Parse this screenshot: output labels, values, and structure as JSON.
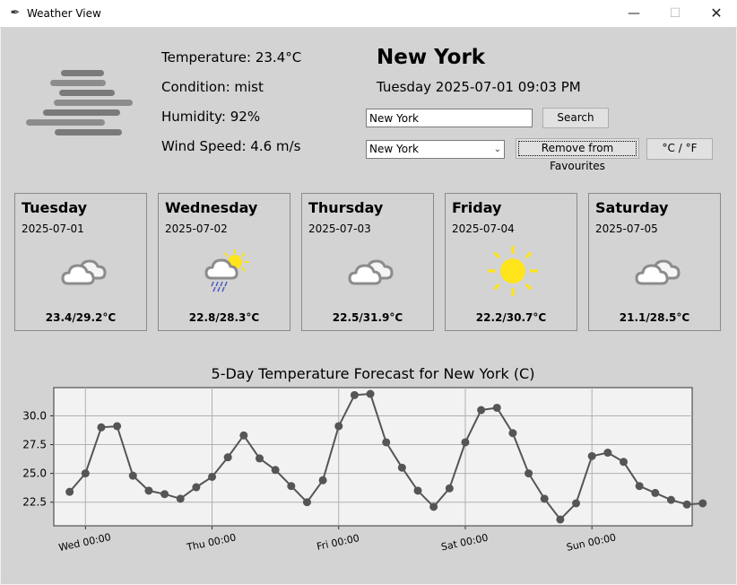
{
  "window": {
    "title": "Weather View",
    "minimize": "—",
    "maximize": "☐",
    "close": "✕"
  },
  "current": {
    "icon": "mist-icon",
    "temperature_text": "Temperature: 23.4°C",
    "condition_text": "Condition: mist",
    "humidity_text": "Humidity: 92%",
    "wind_text": "Wind Speed: 4.6 m/s",
    "city": "New York",
    "datetime": "Tuesday 2025-07-01 09:03 PM"
  },
  "search": {
    "value": "New York",
    "button": "Search"
  },
  "favourites": {
    "selected": "New York",
    "remove_button": "Remove from Favourites",
    "unit_button": "°C / °F"
  },
  "forecast": [
    {
      "day": "Tuesday",
      "date": "2025-07-01",
      "icon": "cloudy-icon",
      "temps": "23.4/29.2°C"
    },
    {
      "day": "Wednesday",
      "date": "2025-07-02",
      "icon": "partly-sunny-rain-icon",
      "temps": "22.8/28.3°C"
    },
    {
      "day": "Thursday",
      "date": "2025-07-03",
      "icon": "cloudy-icon",
      "temps": "22.5/31.9°C"
    },
    {
      "day": "Friday",
      "date": "2025-07-04",
      "icon": "sun-icon",
      "temps": "22.2/30.7°C"
    },
    {
      "day": "Saturday",
      "date": "2025-07-05",
      "icon": "cloudy-icon",
      "temps": "21.1/28.5°C"
    }
  ],
  "colors": {
    "line": "#555555",
    "plot_bg": "#f2f2f2",
    "grid": "#b0b0b0",
    "sun": "#ffe51a",
    "cloud": "#8c8c8c"
  },
  "chart_data": {
    "type": "line",
    "title": "5-Day Temperature Forecast for New York (C)",
    "xlabel": "",
    "ylabel": "",
    "x": [
      "2025-07-01 21:00",
      "2025-07-02 00:00",
      "2025-07-02 03:00",
      "2025-07-02 06:00",
      "2025-07-02 09:00",
      "2025-07-02 12:00",
      "2025-07-02 15:00",
      "2025-07-02 18:00",
      "2025-07-02 21:00",
      "2025-07-03 00:00",
      "2025-07-03 03:00",
      "2025-07-03 06:00",
      "2025-07-03 09:00",
      "2025-07-03 12:00",
      "2025-07-03 15:00",
      "2025-07-03 18:00",
      "2025-07-03 21:00",
      "2025-07-04 00:00",
      "2025-07-04 03:00",
      "2025-07-04 06:00",
      "2025-07-04 09:00",
      "2025-07-04 12:00",
      "2025-07-04 15:00",
      "2025-07-04 18:00",
      "2025-07-04 21:00",
      "2025-07-05 00:00",
      "2025-07-05 03:00",
      "2025-07-05 06:00",
      "2025-07-05 09:00",
      "2025-07-05 12:00",
      "2025-07-05 15:00",
      "2025-07-05 18:00",
      "2025-07-05 21:00",
      "2025-07-06 00:00",
      "2025-07-06 03:00",
      "2025-07-06 06:00",
      "2025-07-06 09:00",
      "2025-07-06 12:00",
      "2025-07-06 15:00",
      "2025-07-06 18:00",
      "2025-07-06 21:00"
    ],
    "series": [
      {
        "values": [
          23.4,
          25.0,
          29.0,
          29.1,
          24.8,
          23.5,
          23.2,
          22.8,
          23.8,
          24.7,
          26.4,
          28.3,
          26.3,
          25.3,
          23.9,
          22.5,
          24.4,
          29.1,
          31.8,
          31.9,
          27.7,
          25.5,
          23.5,
          22.1,
          23.7,
          27.7,
          30.5,
          30.7,
          28.5,
          25.0,
          22.8,
          21.0,
          22.4,
          26.5,
          26.8,
          26.0,
          23.9,
          23.3,
          22.7,
          22.3,
          22.4
        ]
      }
    ],
    "xticks": [
      "Wed 00:00",
      "Thu 00:00",
      "Fri 00:00",
      "Sat 00:00",
      "Sun 00:00"
    ],
    "xtick_dates": [
      "2025-07-02 00:00",
      "2025-07-03 00:00",
      "2025-07-04 00:00",
      "2025-07-05 00:00",
      "2025-07-06 00:00"
    ],
    "xlim": [
      "2025-07-01 18:00",
      "2025-07-06 19:00"
    ],
    "yticks": [
      22.5,
      25.0,
      27.5,
      30.0
    ],
    "ylim": [
      20.45,
      32.45
    ],
    "grid": true,
    "legend": "none"
  }
}
